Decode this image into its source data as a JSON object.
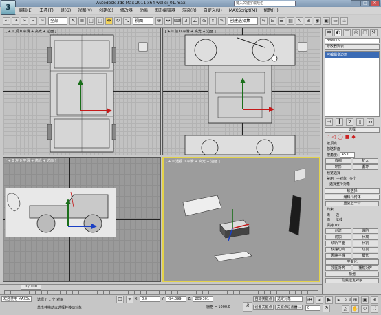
{
  "window": {
    "title": "Autodesk 3ds Max 2011 x64     wellsi_01.max",
    "search_placeholder": "键入关键字或短语",
    "minimize": "–",
    "maximize": "□",
    "close": "✕",
    "logo": "3"
  },
  "menu": [
    "编辑(E)",
    "工具(T)",
    "组(G)",
    "视图(V)",
    "创建(C)",
    "修改器",
    "动画",
    "图形编辑器",
    "渲染(R)",
    "自定义(U)",
    "MAXScript(M)",
    "帮助(H)"
  ],
  "toolbar": {
    "selection_filter": "全部",
    "reference_coord": "视图",
    "named_selection": "创建选择集"
  },
  "viewports": {
    "top_left": "[ + 0 顶 0 平滑 + 高光 + 边面 ]",
    "top_right": "[ + 0 前 0 平滑 + 高光 + 边面 ]",
    "bottom_left": "[ + 0 左 0 平滑 + 高光 + 边面 ]",
    "bottom_right": "[ + 0 透视 0 平滑 + 高光 + 边面 ]"
  },
  "command_panel": {
    "object_name": "Box016",
    "modifier_list": "修改器列表",
    "stack_item": "可编辑多边形",
    "selection_header": "选择",
    "by_vertex": "按顶点",
    "ignore_backfacing": "忽略背面",
    "by_angle": "按角度:",
    "angle_value": "45.0",
    "shrink": "收缩",
    "grow": "扩大",
    "ring": "环形",
    "loop": "循环",
    "preview_selection": "预览选择",
    "off": "禁用",
    "subobject": "子对象",
    "multi": "多个",
    "selected_count": "选择整个对象",
    "soft_selection": "软选择",
    "edit_geometry": "编辑几何体",
    "repeat_last": "重复上一个",
    "constraints": "约束",
    "none": "无",
    "edge": "边",
    "face": "面",
    "normal": "法线",
    "preserve_uvs": "保持 UV",
    "create": "创建",
    "collapse": "塌陷",
    "attach": "附加",
    "detach": "分离",
    "slice_plane": "切片平面",
    "split": "分割",
    "quickslice": "快速切片",
    "cut": "切割",
    "meshsmooth": "网格平滑",
    "tessellate": "细化",
    "make_planar": "平面化",
    "view_align": "视图对齐",
    "grid_align": "栅格对齐",
    "relax": "松弛",
    "hide_selected": "隐藏选定对象"
  },
  "timeline": {
    "frame_display": "0 / 100"
  },
  "status": {
    "selected": "选择了 1 个 对象",
    "prompt": "单击并拖动以选择并移动对象",
    "x_label": "X:",
    "x_value": "0.0",
    "y_label": "Y:",
    "y_value": "-94.099",
    "z_label": "Z:",
    "z_value": "209.301",
    "grid": "栅格 = 1000.0",
    "auto_key": "自动关键点",
    "set_key": "设置关键点",
    "key_filters": "关键点过滤器...",
    "selected_filter": "选定对象",
    "add_time_tag": "添加时间标记",
    "welcome": "欢迎使用 MAXSc",
    "frame": "0"
  }
}
